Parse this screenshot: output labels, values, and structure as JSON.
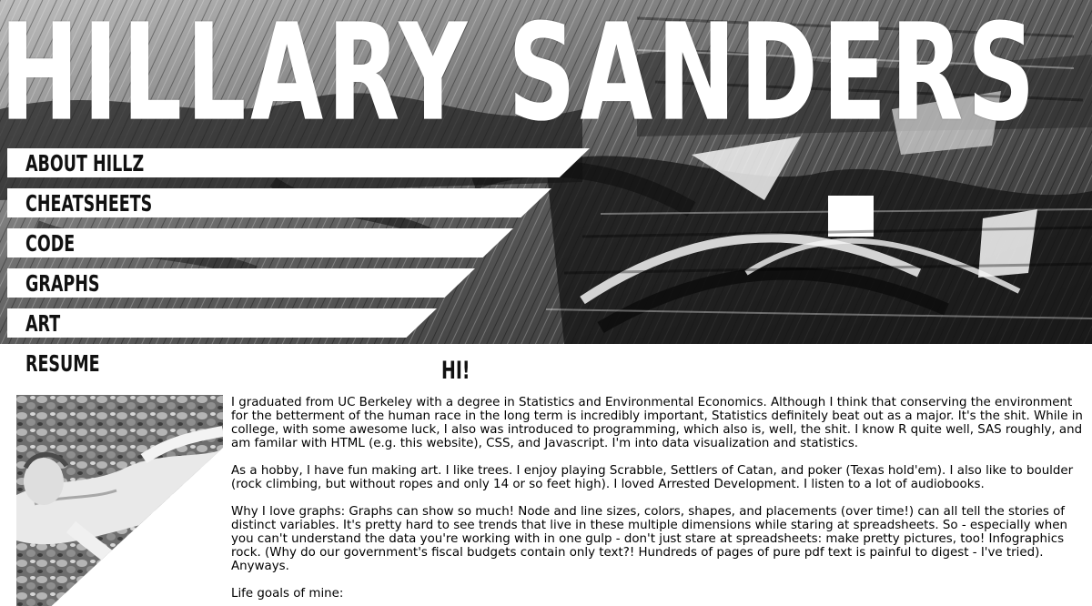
{
  "site": {
    "title": "HILLARY SANDERS"
  },
  "nav": {
    "items": [
      {
        "label": "ABOUT HILLZ"
      },
      {
        "label": "CHEATSHEETS"
      },
      {
        "label": "CODE"
      },
      {
        "label": "GRAPHS"
      },
      {
        "label": "ART"
      },
      {
        "label": "RESUME"
      }
    ]
  },
  "content": {
    "greeting": "HI!",
    "paragraphs": [
      "I graduated from UC Berkeley with a degree in Statistics and Environmental Economics. Although I think that conserving the environment for the betterment of the human race in the long term is incredibly important, Statistics definitely beat out as a major. It's the shit. While in college, with some awesome luck, I also was introduced to programming, which also is, well, the shit. I know R quite well, SAS roughly, and am familar with HTML (e.g. this website), CSS, and Javascript. I'm into data visualization and statistics.",
      "As a hobby, I have fun making art. I like trees. I enjoy playing Scrabble, Settlers of Catan, and poker (Texas hold'em). I also like to boulder (rock climbing, but without ropes and only 14 or so feet high). I loved Arrested Development. I listen to a lot of audiobooks.",
      "Why I love graphs: Graphs can show so much! Node and line sizes, colors, shapes, and placements (over time!) can all tell the stories of distinct variables. It's pretty hard to see trends that live in these multiple dimensions while staring at spreadsheets. So - especially when you can't understand the data you're working with in one gulp - don't just stare at spreadsheets: make pretty pictures, too! Infographics rock. (Why do our government's fiscal budgets contain only text?! Hundreds of pages of pure pdf text is painful to digest - I've tried). Anyways.",
      "Life goals of mine:"
    ]
  },
  "colors": {
    "background": "#ffffff",
    "text": "#000000",
    "title": "#ffffff",
    "art_dark": "#1a1a1a",
    "art_mid": "#7a7a7a",
    "art_light": "#dcdcdc"
  }
}
